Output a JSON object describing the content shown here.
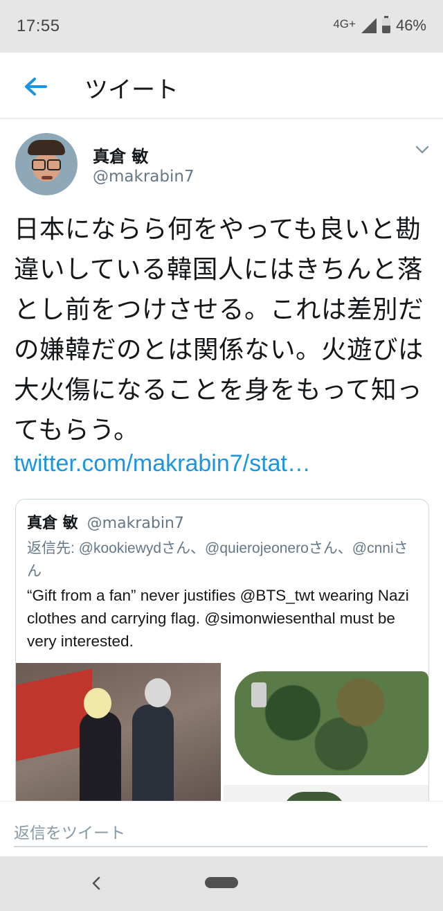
{
  "status_bar": {
    "time": "17:55",
    "network": "4G+",
    "battery": "46%"
  },
  "header": {
    "title": "ツイート",
    "back_icon": "arrow-left-icon"
  },
  "tweet": {
    "author_name": "真倉 敏",
    "author_handle": "@makrabin7",
    "text": "日本にならら何をやっても良いと勘違いしている韓国人にはきちんと落とし前をつけさせる。これは差別だの嫌韓だのとは関係ない。火遊びは大火傷になることを身をもって知ってもらう。",
    "link": "twitter.com/makrabin7/stat…"
  },
  "quoted_tweet": {
    "author_name": "真倉 敏",
    "author_handle": "@makrabin7",
    "reply_to": "返信先: @kookiewydさん、@quierojeoneroさん、@cnniさん",
    "text": "“Gift from a fan” never justifies @BTS_twt wearing Nazi clothes and carrying flag. @simonwiesenthal must be very interested."
  },
  "reply_bar": {
    "placeholder": "返信をツイート"
  },
  "colors": {
    "accent": "#1b95e0",
    "secondary_text": "#657786"
  }
}
